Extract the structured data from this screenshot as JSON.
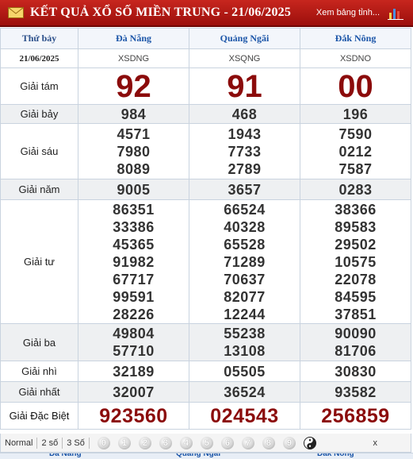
{
  "header": {
    "title": "KẾT QUẢ XỔ SỐ MIỀN TRUNG - 21/06/2025",
    "link_label": "Xem bảng tỉnh...",
    "icons": [
      "mail-icon",
      "bar-chart-icon"
    ]
  },
  "table": {
    "day": "Thứ bảy",
    "date": "21/06/2025",
    "provinces": [
      {
        "name": "Đà Nẵng",
        "code": "XSDNG"
      },
      {
        "name": "Quảng Ngãi",
        "code": "XSQNG"
      },
      {
        "name": "Đắk Nông",
        "code": "XSDNO"
      }
    ],
    "prizes": [
      {
        "label": "Giải tám",
        "values": [
          [
            "92"
          ],
          [
            "91"
          ],
          [
            "00"
          ]
        ]
      },
      {
        "label": "Giải bảy",
        "values": [
          [
            "984"
          ],
          [
            "468"
          ],
          [
            "196"
          ]
        ]
      },
      {
        "label": "Giải sáu",
        "values": [
          [
            "4571",
            "7980",
            "8089"
          ],
          [
            "1943",
            "7733",
            "2789"
          ],
          [
            "7590",
            "0212",
            "7587"
          ]
        ]
      },
      {
        "label": "Giải năm",
        "values": [
          [
            "9005"
          ],
          [
            "3657"
          ],
          [
            "0283"
          ]
        ]
      },
      {
        "label": "Giải tư",
        "values": [
          [
            "86351",
            "33386",
            "45365",
            "91982",
            "67717",
            "99591",
            "28226"
          ],
          [
            "66524",
            "40328",
            "65528",
            "71289",
            "70637",
            "82077",
            "12244"
          ],
          [
            "38366",
            "89583",
            "29502",
            "10575",
            "22078",
            "84595",
            "37851"
          ]
        ]
      },
      {
        "label": "Giải ba",
        "values": [
          [
            "49804",
            "57710"
          ],
          [
            "55238",
            "13108"
          ],
          [
            "90090",
            "81706"
          ]
        ]
      },
      {
        "label": "Giải nhì",
        "values": [
          [
            "32189"
          ],
          [
            "05505"
          ],
          [
            "30830"
          ]
        ]
      },
      {
        "label": "Giải nhất",
        "values": [
          [
            "32007"
          ],
          [
            "36524"
          ],
          [
            "93582"
          ]
        ]
      },
      {
        "label": "Giải Đặc Biệt",
        "values": [
          [
            "923560"
          ],
          [
            "024543"
          ],
          [
            "256859"
          ]
        ]
      }
    ]
  },
  "toolbar": {
    "modes": [
      "Normal",
      "2 số",
      "3 Số"
    ],
    "digits": [
      "0",
      "1",
      "2",
      "3",
      "4",
      "5",
      "6",
      "7",
      "8",
      "9"
    ],
    "close_label": "x"
  },
  "colors": {
    "header_bg": "#b01a15",
    "province_text": "#1b55a8",
    "prize_red": "#8b0b0b",
    "row_shade": "#eef0f2",
    "border": "#c9d3df"
  }
}
